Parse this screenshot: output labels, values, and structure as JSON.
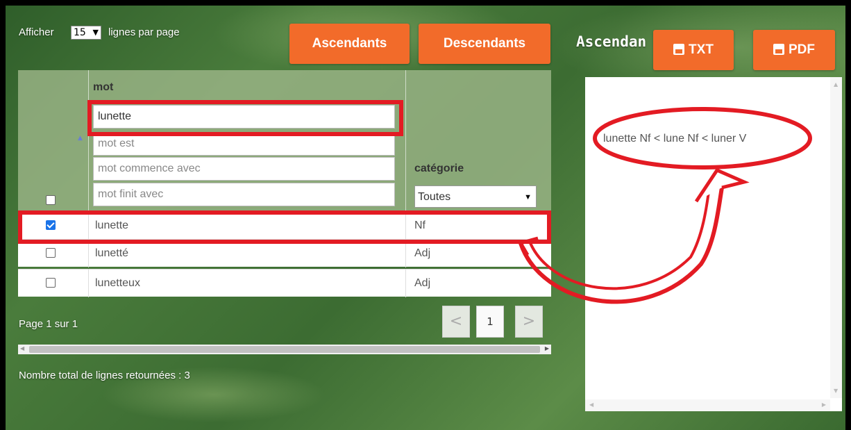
{
  "controls": {
    "show_prefix": "Afficher",
    "rows_per_page": "15",
    "show_suffix": "lignes par page"
  },
  "buttons": {
    "ascendants": "Ascendants",
    "descendants": "Descendants",
    "txt": "TXT",
    "pdf": "PDF"
  },
  "right_panel": {
    "title": "Ascendan",
    "result": "lunette Nf < lune Nf < luner V"
  },
  "table": {
    "col_mot": "mot",
    "col_categorie": "catégorie",
    "filters": {
      "mot_value": "lunette",
      "mot_est_placeholder": "mot est",
      "mot_commence_placeholder": "mot commence avec",
      "mot_finit_placeholder": "mot finit avec",
      "categorie_selected": "Toutes"
    },
    "rows": [
      {
        "mot": "lunette",
        "categorie": "Nf",
        "checked": true
      },
      {
        "mot": "lunetté",
        "categorie": "Adj",
        "checked": false
      },
      {
        "mot": "lunetteux",
        "categorie": "Adj",
        "checked": false
      }
    ]
  },
  "pagination": {
    "page_info": "Page 1 sur 1",
    "current_page": "1",
    "prev": "<",
    "next": ">"
  },
  "summary": {
    "total_rows": "Nombre total de lignes retournées : 3"
  },
  "colors": {
    "accent": "#f26b2a",
    "annotation_red": "#e31b23",
    "checkbox_blue": "#1a73e8"
  }
}
